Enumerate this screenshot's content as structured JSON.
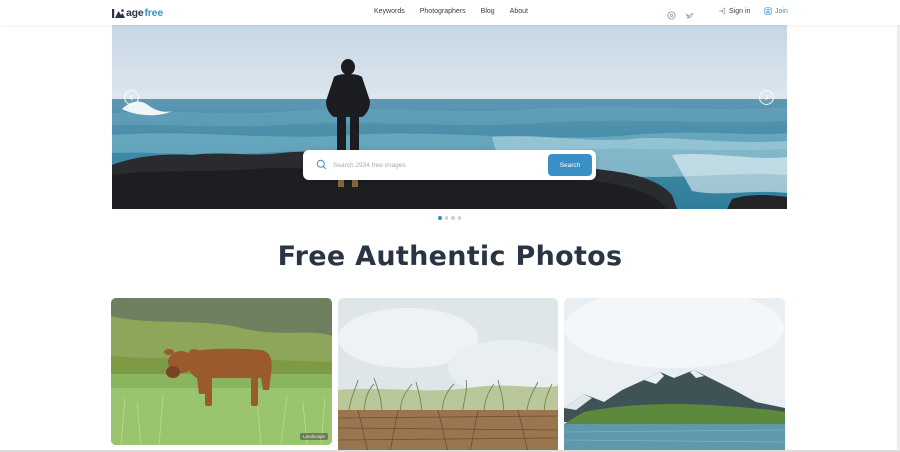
{
  "brand": {
    "name_dark": "age",
    "name_accent": "free"
  },
  "nav": {
    "links": [
      {
        "label": "Keywords"
      },
      {
        "label": "Photographers"
      },
      {
        "label": "Blog"
      },
      {
        "label": "About"
      }
    ]
  },
  "social": {
    "icons": [
      "globe-icon",
      "bird-icon"
    ]
  },
  "auth": {
    "sign_in_label": "Sign in",
    "join_label": "Join"
  },
  "hero": {
    "search": {
      "placeholder": "Search 2934 free images",
      "value": "",
      "button_label": "Search"
    },
    "carousel": {
      "slide_count": 4,
      "active_slide": 1
    }
  },
  "main": {
    "title": "Free Authentic Photos"
  },
  "gallery": {
    "photos": [
      {
        "subject": "cow in grass field",
        "tag": "Landscape"
      },
      {
        "subject": "dry grass close-up"
      },
      {
        "subject": "snowy mountain over fjord"
      }
    ]
  },
  "colors": {
    "accent": "#3a8fc7",
    "text": "#2b3442",
    "search_button": "#3a8fc7"
  }
}
